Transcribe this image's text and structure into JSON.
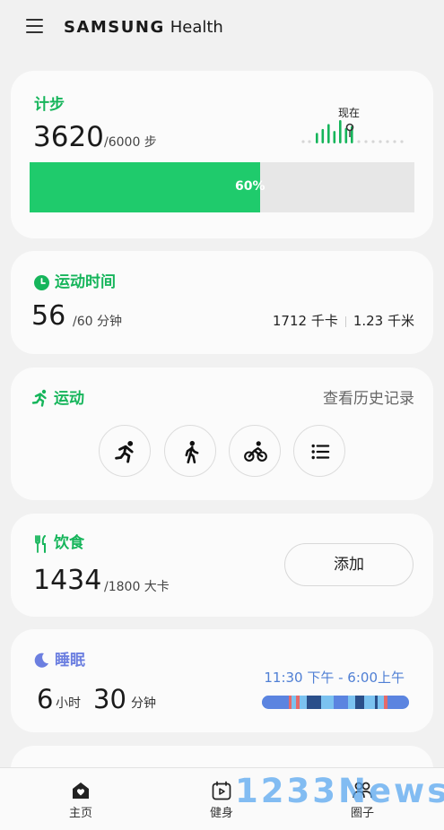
{
  "header": {
    "brand_bold": "SAMSUNG",
    "brand_light": "Health"
  },
  "steps": {
    "title": "计步",
    "value": "3620",
    "goal": "/6000 步",
    "progress_label": "60%",
    "progress_fraction": 0.6,
    "now_label": "现在",
    "mini_bars": [
      0.35,
      0.55,
      0.8,
      0.45,
      1.0,
      0.6,
      0.7
    ]
  },
  "exercise_time": {
    "title": "运动时间",
    "value": "56",
    "goal": "/60 分钟",
    "calories": "1712 千卡",
    "distance": "1.23 千米"
  },
  "exercise": {
    "title": "运动",
    "history_link": "查看历史记录",
    "buttons": [
      "running-icon",
      "walking-icon",
      "cycling-icon",
      "list-icon"
    ]
  },
  "food": {
    "title": "饮食",
    "value": "1434",
    "goal": "/1800 大卡",
    "add_label": "添加"
  },
  "sleep": {
    "title": "睡眠",
    "hours": "6",
    "hours_unit": "小时",
    "minutes": "30",
    "minutes_unit": "分钟",
    "time_range": "11:30 下午 - 6:00上午"
  },
  "bottom_nav": {
    "items": [
      {
        "label": "主页",
        "icon": "home-icon"
      },
      {
        "label": "健身",
        "icon": "fitness-icon"
      },
      {
        "label": "圈子",
        "icon": "together-icon"
      }
    ]
  },
  "watermark": "1233News",
  "colors": {
    "accent_green": "#16b55b",
    "progress_green": "#1fcb6c",
    "sleep_blue": "#4f7fd4"
  }
}
